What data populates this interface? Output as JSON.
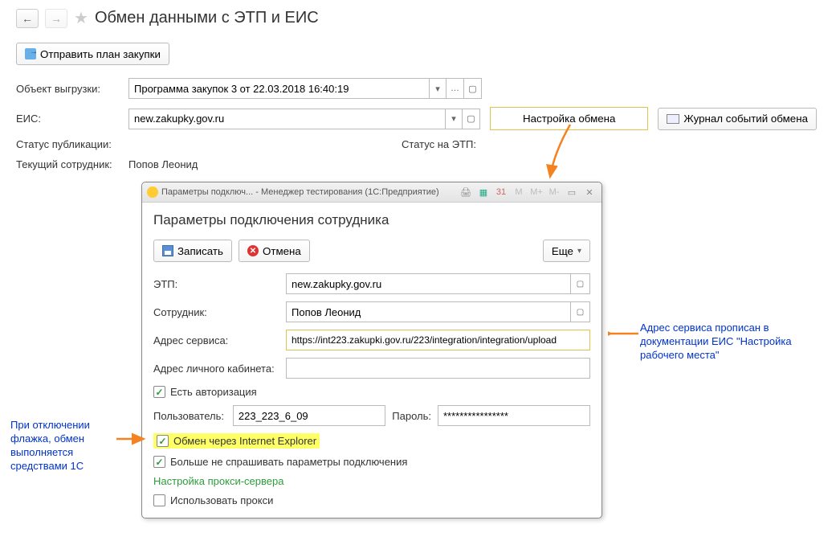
{
  "page": {
    "title": "Обмен данными с ЭТП и ЕИС"
  },
  "toolbar": {
    "send_plan": "Отправить план закупки"
  },
  "fields": {
    "object_label": "Объект выгрузки:",
    "object_value": "Программа закупок 3 от 22.03.2018 16:40:19",
    "eis_label": "ЕИС:",
    "eis_value": "new.zakupky.gov.ru",
    "config_button": "Настройка обмена",
    "log_button": "Журнал событий обмена",
    "pub_status_label": "Статус публикации:",
    "etp_status_label": "Статус на ЭТП:",
    "employee_label": "Текущий сотрудник:",
    "employee_value": "Попов Леонид"
  },
  "dialog": {
    "window_title": "Параметры подключ...  - Менеджер тестирования (1С:Предприятие)",
    "mem_m": "M",
    "mem_mp": "M+",
    "mem_mm": "M-",
    "heading": "Параметры подключения сотрудника",
    "save": "Записать",
    "cancel": "Отмена",
    "more": "Еще",
    "etp_label": "ЭТП:",
    "etp_value": "new.zakupky.gov.ru",
    "employee_label": "Сотрудник:",
    "employee_value": "Попов Леонид",
    "service_label": "Адрес сервиса:",
    "service_value": "https://int223.zakupki.gov.ru/223/integration/integration/upload",
    "cabinet_label": "Адрес личного кабинета:",
    "has_auth": "Есть авторизация",
    "user_label": "Пользователь:",
    "user_value": "223_223_6_09",
    "pass_label": "Пароль:",
    "pass_value": "****************",
    "ie_exchange": "Обмен через Internet Explorer",
    "dont_ask": "Больше не спрашивать параметры подключения",
    "proxy_link": "Настройка прокси-сервера",
    "use_proxy": "Использовать прокси"
  },
  "annotations": {
    "left": "При отключении флажка, обмен выполняется средствами 1С",
    "right": "Адрес сервиса прописан в документации ЕИС \"Настройка рабочего места\""
  }
}
